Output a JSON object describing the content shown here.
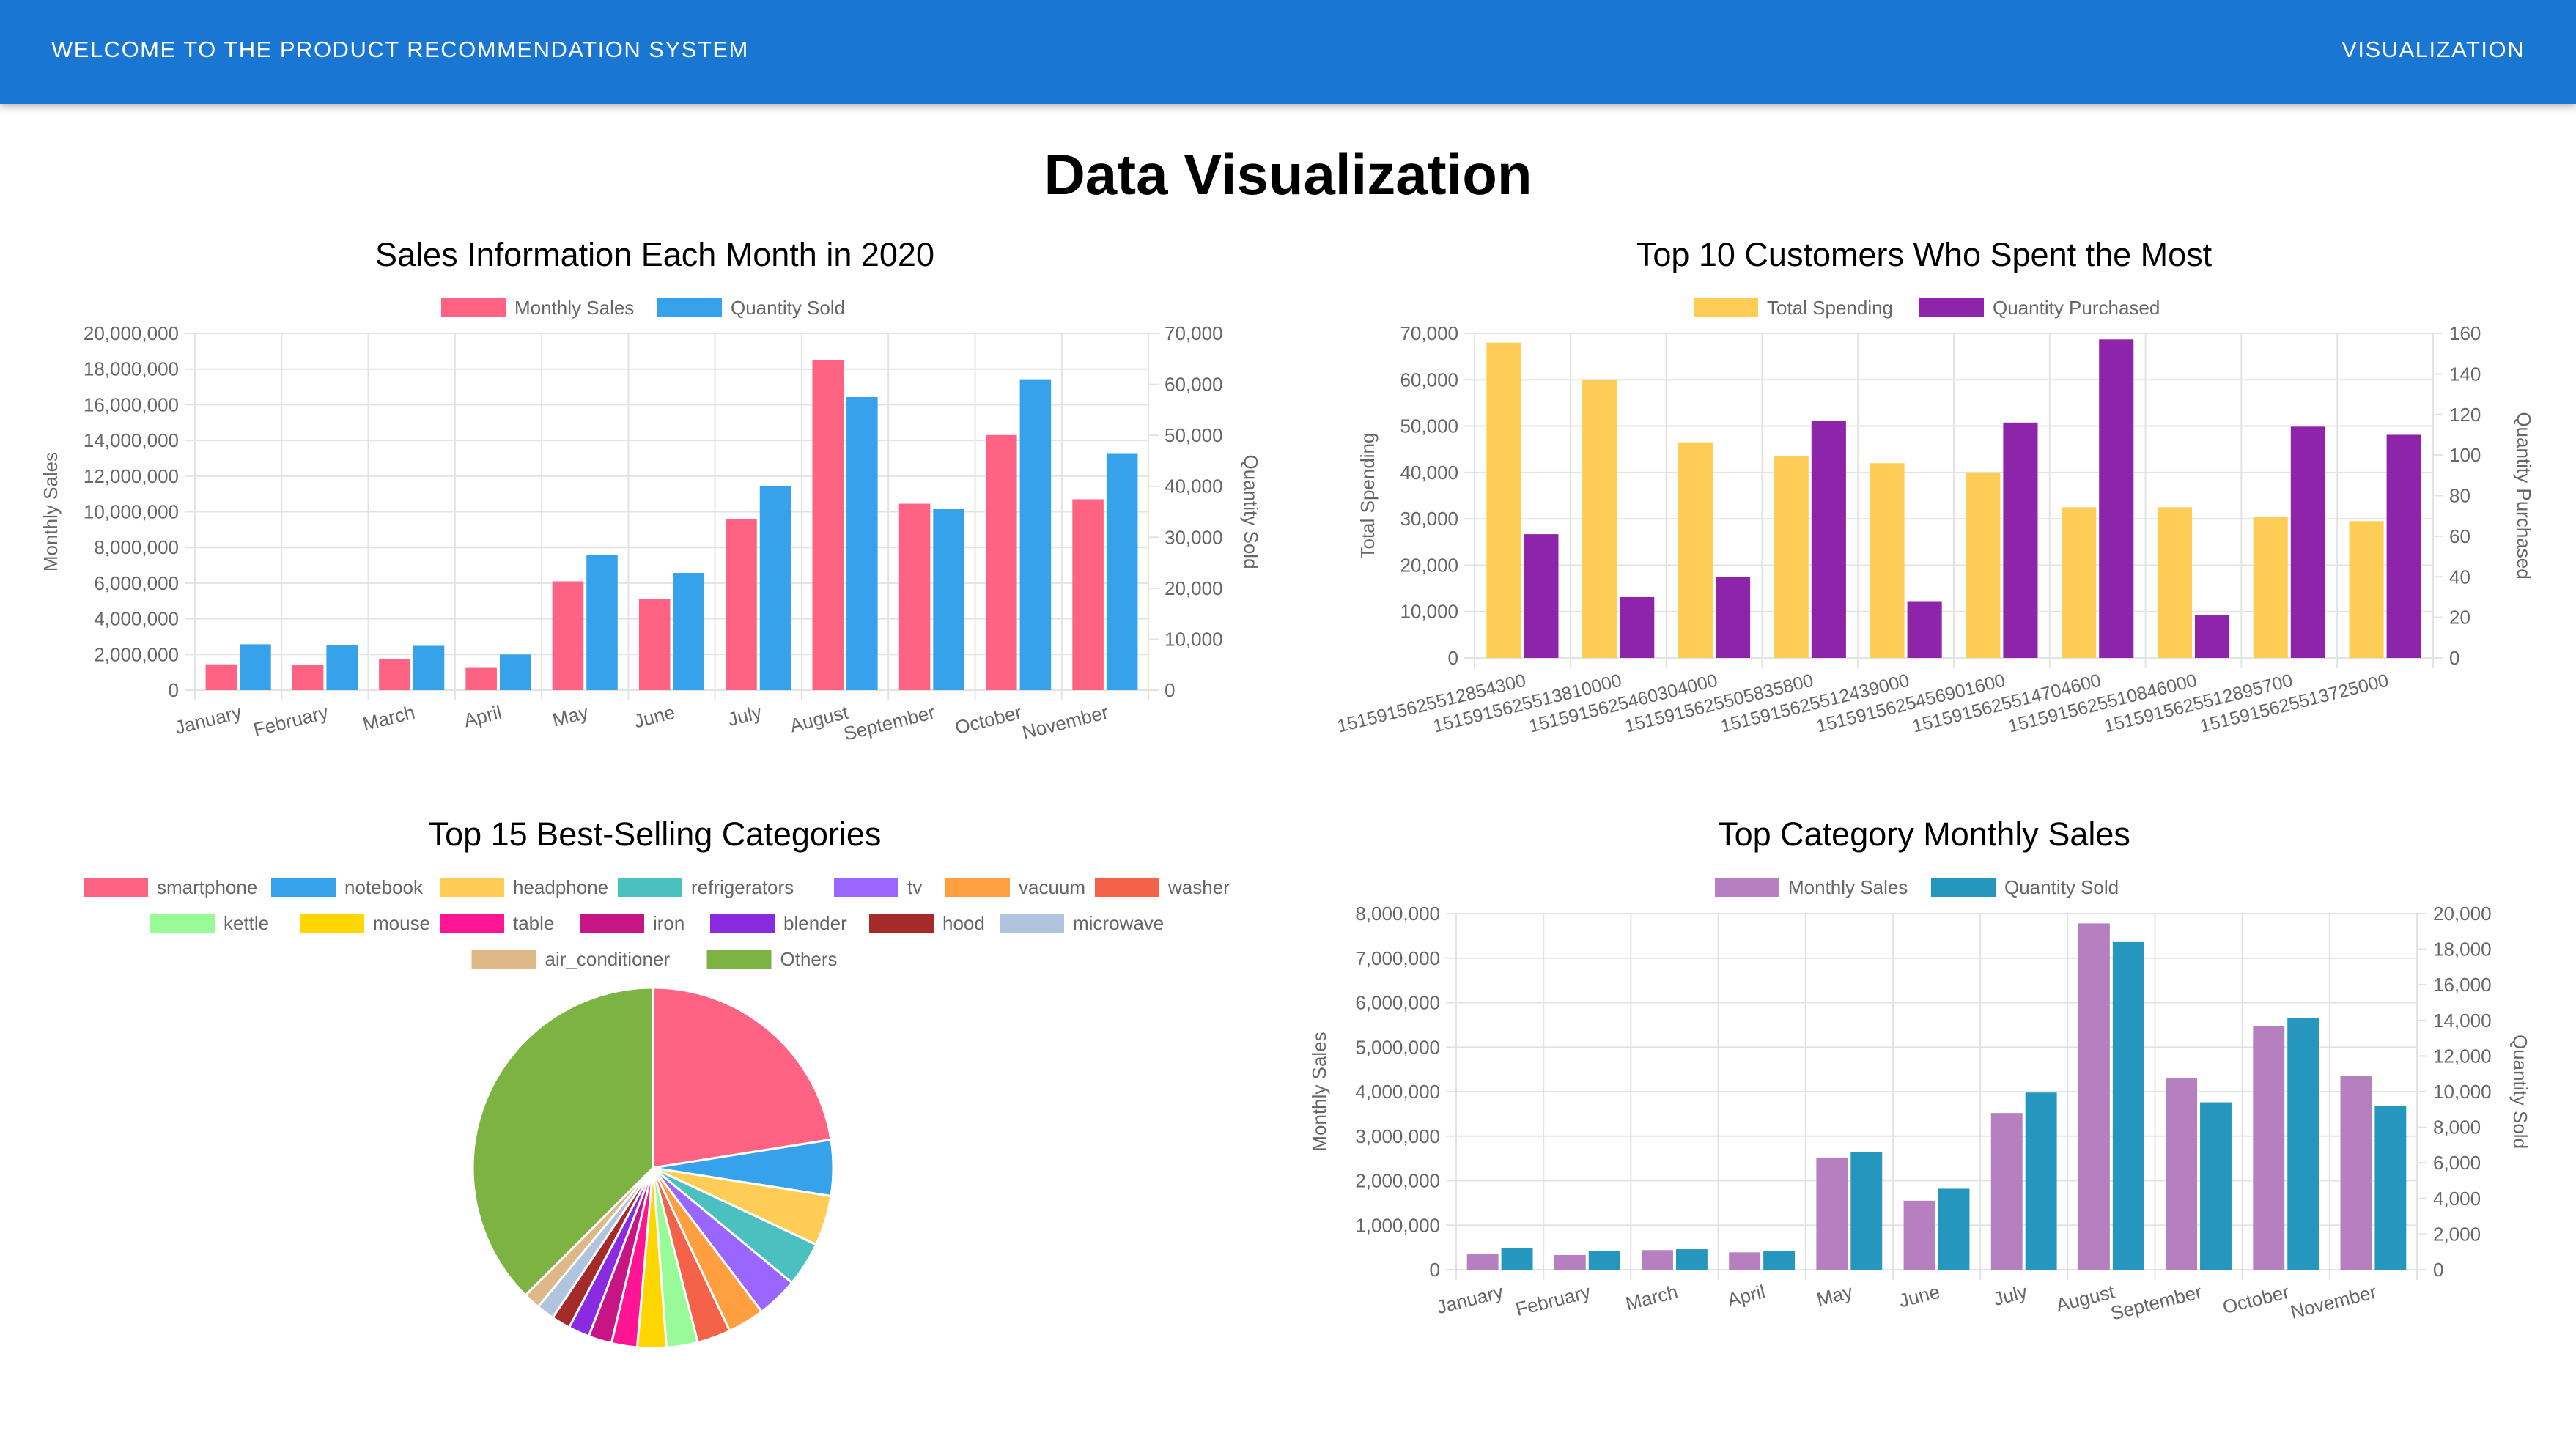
{
  "appbar": {
    "brand": "WELCOME TO THE PRODUCT RECOMMENDATION SYSTEM",
    "nav_visualization": "VISUALIZATION"
  },
  "page": {
    "title": "Data Visualization"
  },
  "colors": {
    "appbar": "#1976d2",
    "monthly_sales": "#ff6384",
    "quantity_sold": "#36a2eb",
    "total_spending": "#ffcd56",
    "quantity_purchased": "#8e24aa",
    "category_monthly_sales": "#b57fc0",
    "category_quantity_sold": "#2596be"
  },
  "chart_data": [
    {
      "id": "sales2020",
      "type": "bar",
      "title": "Sales Information Each Month in 2020",
      "legend_position": "top",
      "grid": true,
      "categories": [
        "January",
        "February",
        "March",
        "April",
        "May",
        "June",
        "July",
        "August",
        "September",
        "October",
        "November"
      ],
      "series": [
        {
          "name": "Monthly Sales",
          "axis": "left",
          "color": "#ff6384",
          "values": [
            1450000,
            1400000,
            1750000,
            1250000,
            6100000,
            5100000,
            9600000,
            18500000,
            10450000,
            14300000,
            10700000
          ]
        },
        {
          "name": "Quantity Sold",
          "axis": "right",
          "color": "#36a2eb",
          "values": [
            9000,
            8800,
            8700,
            7000,
            26500,
            23000,
            40000,
            57500,
            35500,
            61000,
            46500
          ]
        }
      ],
      "ylabel": "Monthly Sales",
      "ylim": [
        0,
        20000000
      ],
      "yticks": [
        "0",
        "2,000,000",
        "4,000,000",
        "6,000,000",
        "8,000,000",
        "10,000,000",
        "12,000,000",
        "14,000,000",
        "16,000,000",
        "18,000,000",
        "20,000,000"
      ],
      "y2label": "Quantity Sold",
      "y2lim": [
        0,
        70000
      ],
      "y2ticks": [
        "0",
        "10,000",
        "20,000",
        "30,000",
        "40,000",
        "50,000",
        "60,000",
        "70,000"
      ]
    },
    {
      "id": "topcustomers",
      "type": "bar",
      "title": "Top 10 Customers Who Spent the Most",
      "legend_position": "top",
      "grid": true,
      "categories": [
        "1515915625512854300",
        "1515915625513810000",
        "1515915625460304000",
        "1515915625505835800",
        "1515915625512439000",
        "1515915625456901600",
        "1515915625514704600",
        "1515915625510846000",
        "1515915625512895700",
        "1515915625513725000"
      ],
      "series": [
        {
          "name": "Total Spending",
          "axis": "left",
          "color": "#ffcd56",
          "values": [
            68000,
            60000,
            46500,
            43500,
            42000,
            40000,
            32500,
            32500,
            30500,
            29500
          ]
        },
        {
          "name": "Quantity Purchased",
          "axis": "right",
          "color": "#8e24aa",
          "values": [
            61,
            30,
            40,
            117,
            28,
            116,
            157,
            21,
            114,
            110
          ]
        }
      ],
      "ylabel": "Total Spending",
      "ylim": [
        0,
        70000
      ],
      "yticks": [
        "0",
        "10,000",
        "20,000",
        "30,000",
        "40,000",
        "50,000",
        "60,000",
        "70,000"
      ],
      "y2label": "Quantity Purchased",
      "y2lim": [
        0,
        160
      ],
      "y2ticks": [
        "0",
        "20",
        "40",
        "60",
        "80",
        "100",
        "120",
        "140",
        "160"
      ]
    },
    {
      "id": "categories",
      "type": "pie",
      "title": "Top 15 Best-Selling Categories",
      "legend_position": "top",
      "slices": [
        {
          "label": "smartphone",
          "value": 22.5,
          "color": "#ff6384"
        },
        {
          "label": "notebook",
          "value": 5.0,
          "color": "#36a2eb"
        },
        {
          "label": "headphone",
          "value": 4.5,
          "color": "#ffcd56"
        },
        {
          "label": "refrigerators",
          "value": 4.0,
          "color": "#4bc0c0"
        },
        {
          "label": "tv",
          "value": 3.7,
          "color": "#9966ff"
        },
        {
          "label": "vacuum",
          "value": 3.3,
          "color": "#ff9f40"
        },
        {
          "label": "washer",
          "value": 3.0,
          "color": "#f4624a"
        },
        {
          "label": "kettle",
          "value": 2.8,
          "color": "#98fb98"
        },
        {
          "label": "mouse",
          "value": 2.6,
          "color": "#ffd700"
        },
        {
          "label": "table",
          "value": 2.3,
          "color": "#ff1493"
        },
        {
          "label": "iron",
          "value": 2.1,
          "color": "#c71585"
        },
        {
          "label": "blender",
          "value": 1.9,
          "color": "#8a2be2"
        },
        {
          "label": "hood",
          "value": 1.7,
          "color": "#a52a2a"
        },
        {
          "label": "microwave",
          "value": 1.6,
          "color": "#b0c4de"
        },
        {
          "label": "air_conditioner",
          "value": 1.5,
          "color": "#deb887"
        },
        {
          "label": "Others",
          "value": 37.5,
          "color": "#7cb342"
        }
      ]
    },
    {
      "id": "topcategory",
      "type": "bar",
      "title": "Top Category Monthly Sales",
      "legend_position": "top",
      "grid": true,
      "categories": [
        "January",
        "February",
        "March",
        "April",
        "May",
        "June",
        "July",
        "August",
        "September",
        "October",
        "November"
      ],
      "series": [
        {
          "name": "Monthly Sales",
          "axis": "left",
          "color": "#b57fc0",
          "values": [
            350000,
            330000,
            440000,
            390000,
            2520000,
            1550000,
            3520000,
            7780000,
            4300000,
            5480000,
            4350000
          ]
        },
        {
          "name": "Quantity Sold",
          "axis": "right",
          "color": "#2596be",
          "values": [
            1200,
            1050,
            1150,
            1050,
            6600,
            4550,
            9950,
            18400,
            9400,
            14150,
            9200
          ]
        }
      ],
      "ylabel": "Monthly Sales",
      "ylim": [
        0,
        8000000
      ],
      "yticks": [
        "0",
        "1,000,000",
        "2,000,000",
        "3,000,000",
        "4,000,000",
        "5,000,000",
        "6,000,000",
        "7,000,000",
        "8,000,000"
      ],
      "y2label": "Quantity Sold",
      "y2lim": [
        0,
        20000
      ],
      "y2ticks": [
        "0",
        "2,000",
        "4,000",
        "6,000",
        "8,000",
        "10,000",
        "12,000",
        "14,000",
        "16,000",
        "18,000",
        "20,000"
      ]
    }
  ]
}
